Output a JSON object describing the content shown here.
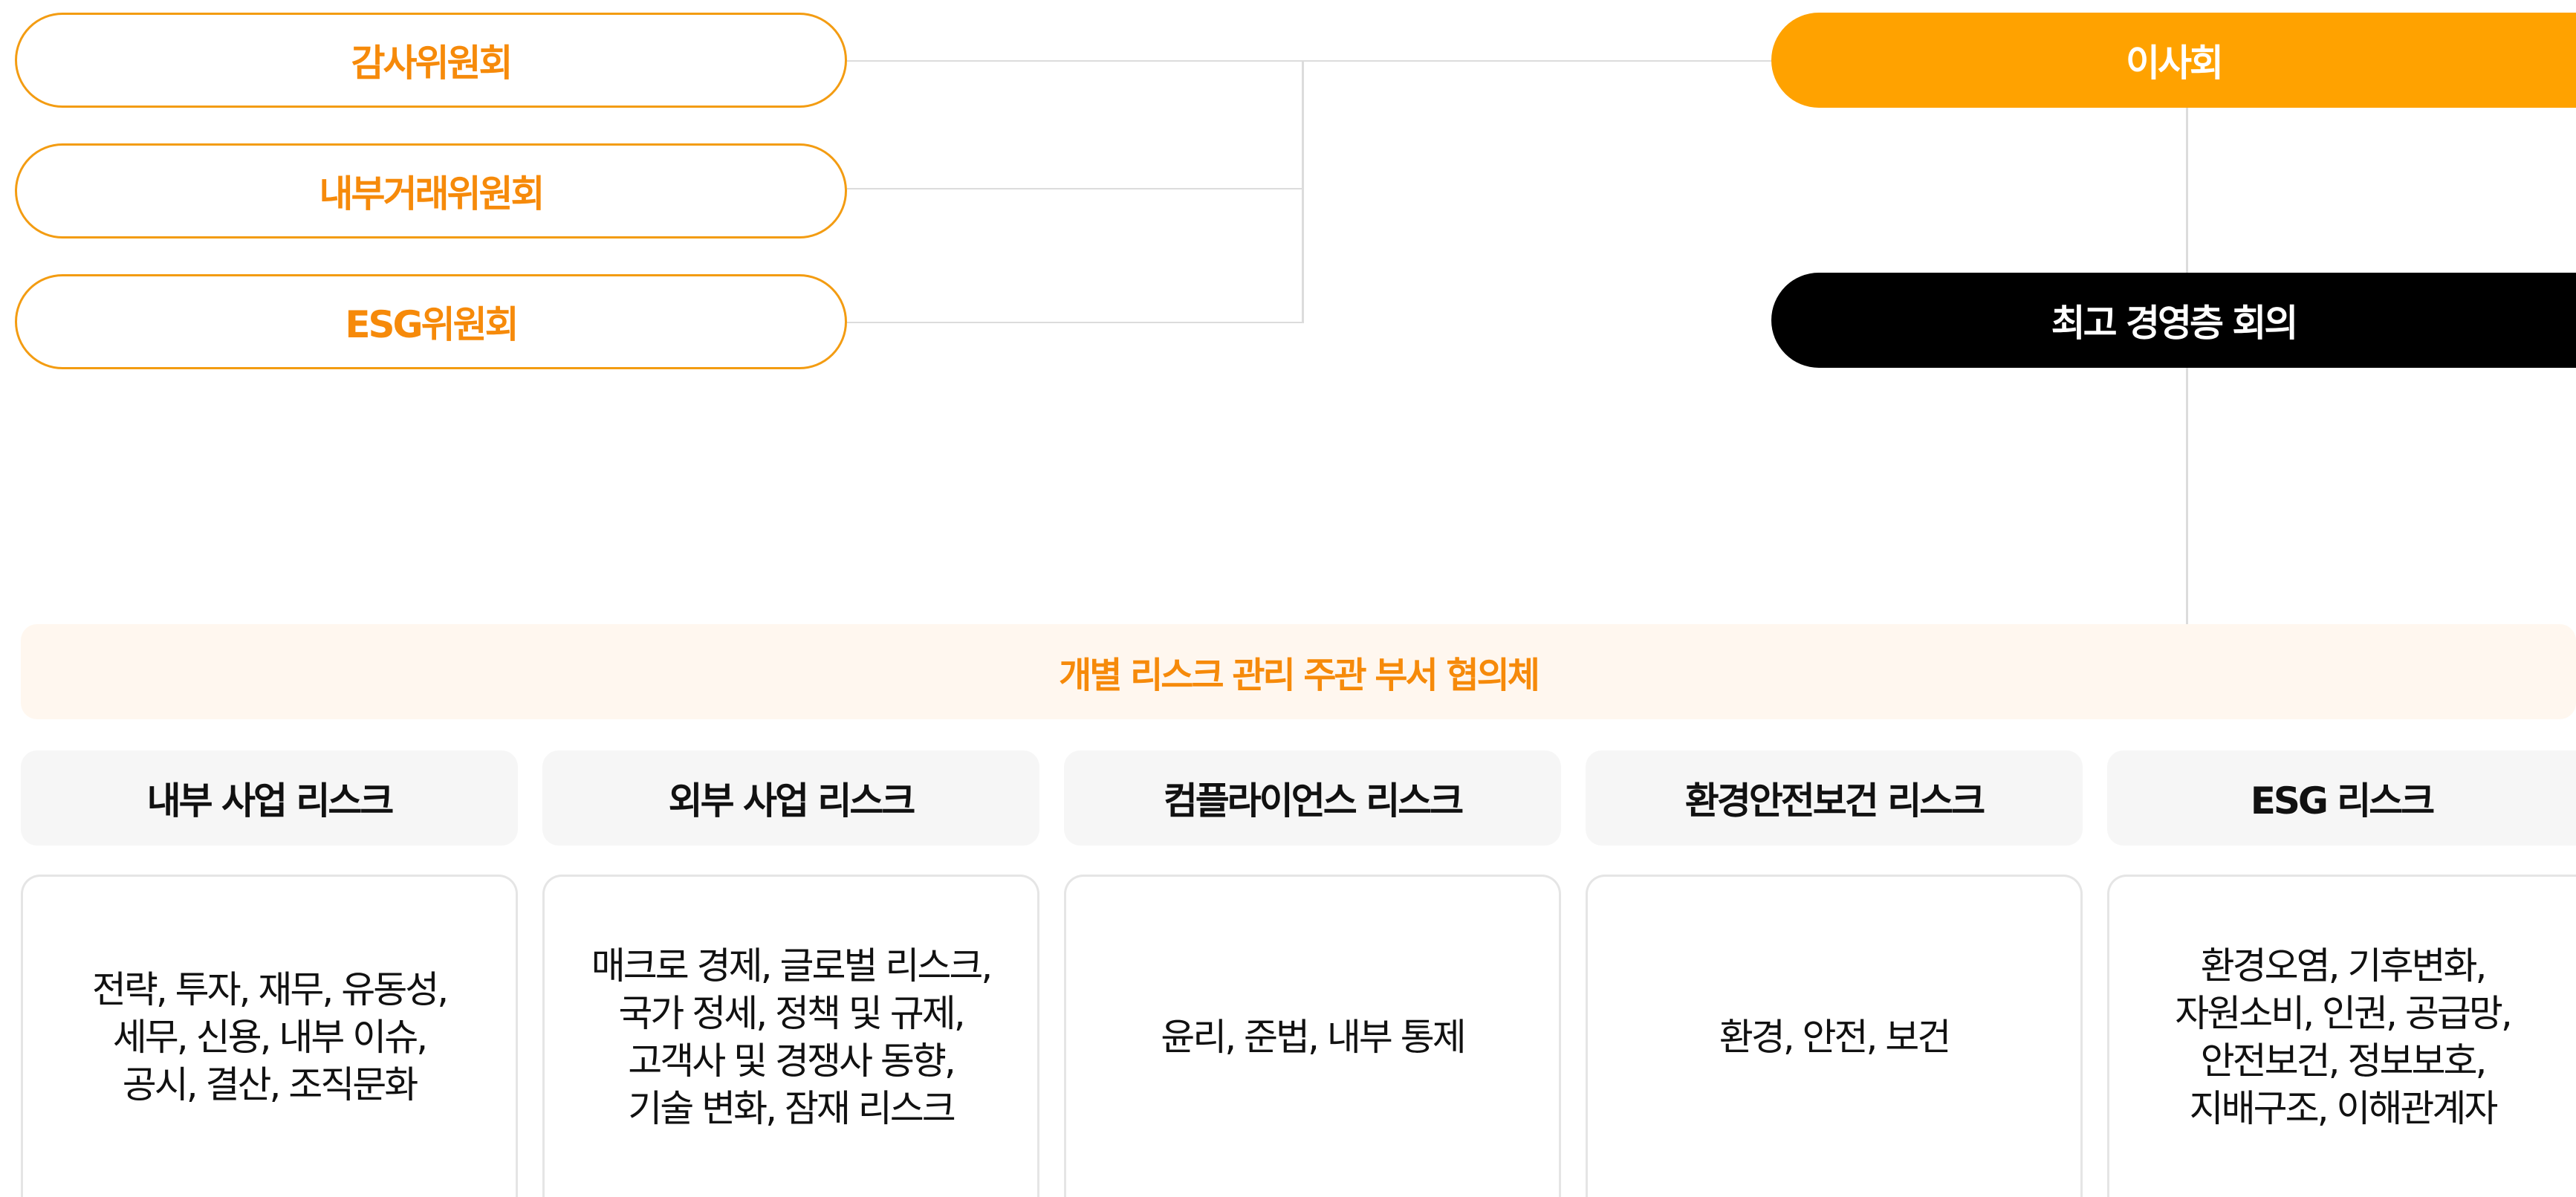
{
  "committees": [
    {
      "label": "감사위원회"
    },
    {
      "label": "내부거래위원회"
    },
    {
      "label": "ESG위원회"
    }
  ],
  "board": {
    "label": "이사회"
  },
  "executive": {
    "label": "최고 경영층 회의"
  },
  "council": {
    "label": "개별 리스크 관리 주관 부서 협의체"
  },
  "risks": [
    {
      "title": "내부 사업 리스크",
      "body": "전략, 투자, 재무, 유동성,\n세무, 신용, 내부 이슈,\n공시, 결산, 조직문화"
    },
    {
      "title": "외부 사업 리스크",
      "body": "매크로 경제, 글로벌 리스크,\n국가 정세, 정책 및 규제,\n고객사 및 경쟁사 동향,\n기술 변화, 잠재 리스크"
    },
    {
      "title": "컴플라이언스 리스크",
      "body": "윤리, 준법, 내부 통제"
    },
    {
      "title": "환경안전보건 리스크",
      "body": "환경, 안전, 보건"
    },
    {
      "title": "ESG 리스크",
      "body": "환경오염, 기후변화,\n자원소비, 인권, 공급망,\n안전보건, 정보보호,\n지배구조, 이해관계자"
    }
  ],
  "colors": {
    "accent": "#FFA200",
    "accent_text": "#F68A0A",
    "black": "#000000",
    "line": "#DCDCDC"
  }
}
